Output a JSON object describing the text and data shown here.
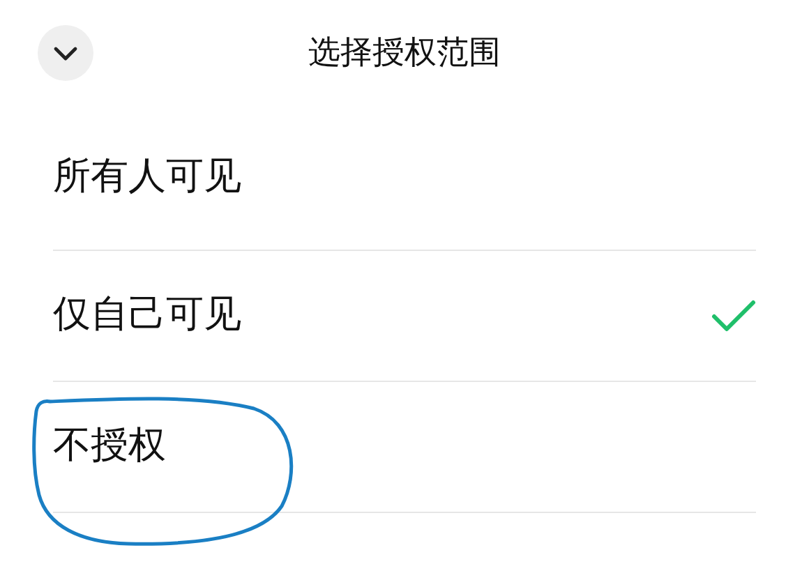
{
  "header": {
    "title": "选择授权范围"
  },
  "options": [
    {
      "label": "所有人可见",
      "selected": false,
      "circled": false
    },
    {
      "label": "仅自己可见",
      "selected": true,
      "circled": false
    },
    {
      "label": "不授权",
      "selected": false,
      "circled": true
    }
  ]
}
